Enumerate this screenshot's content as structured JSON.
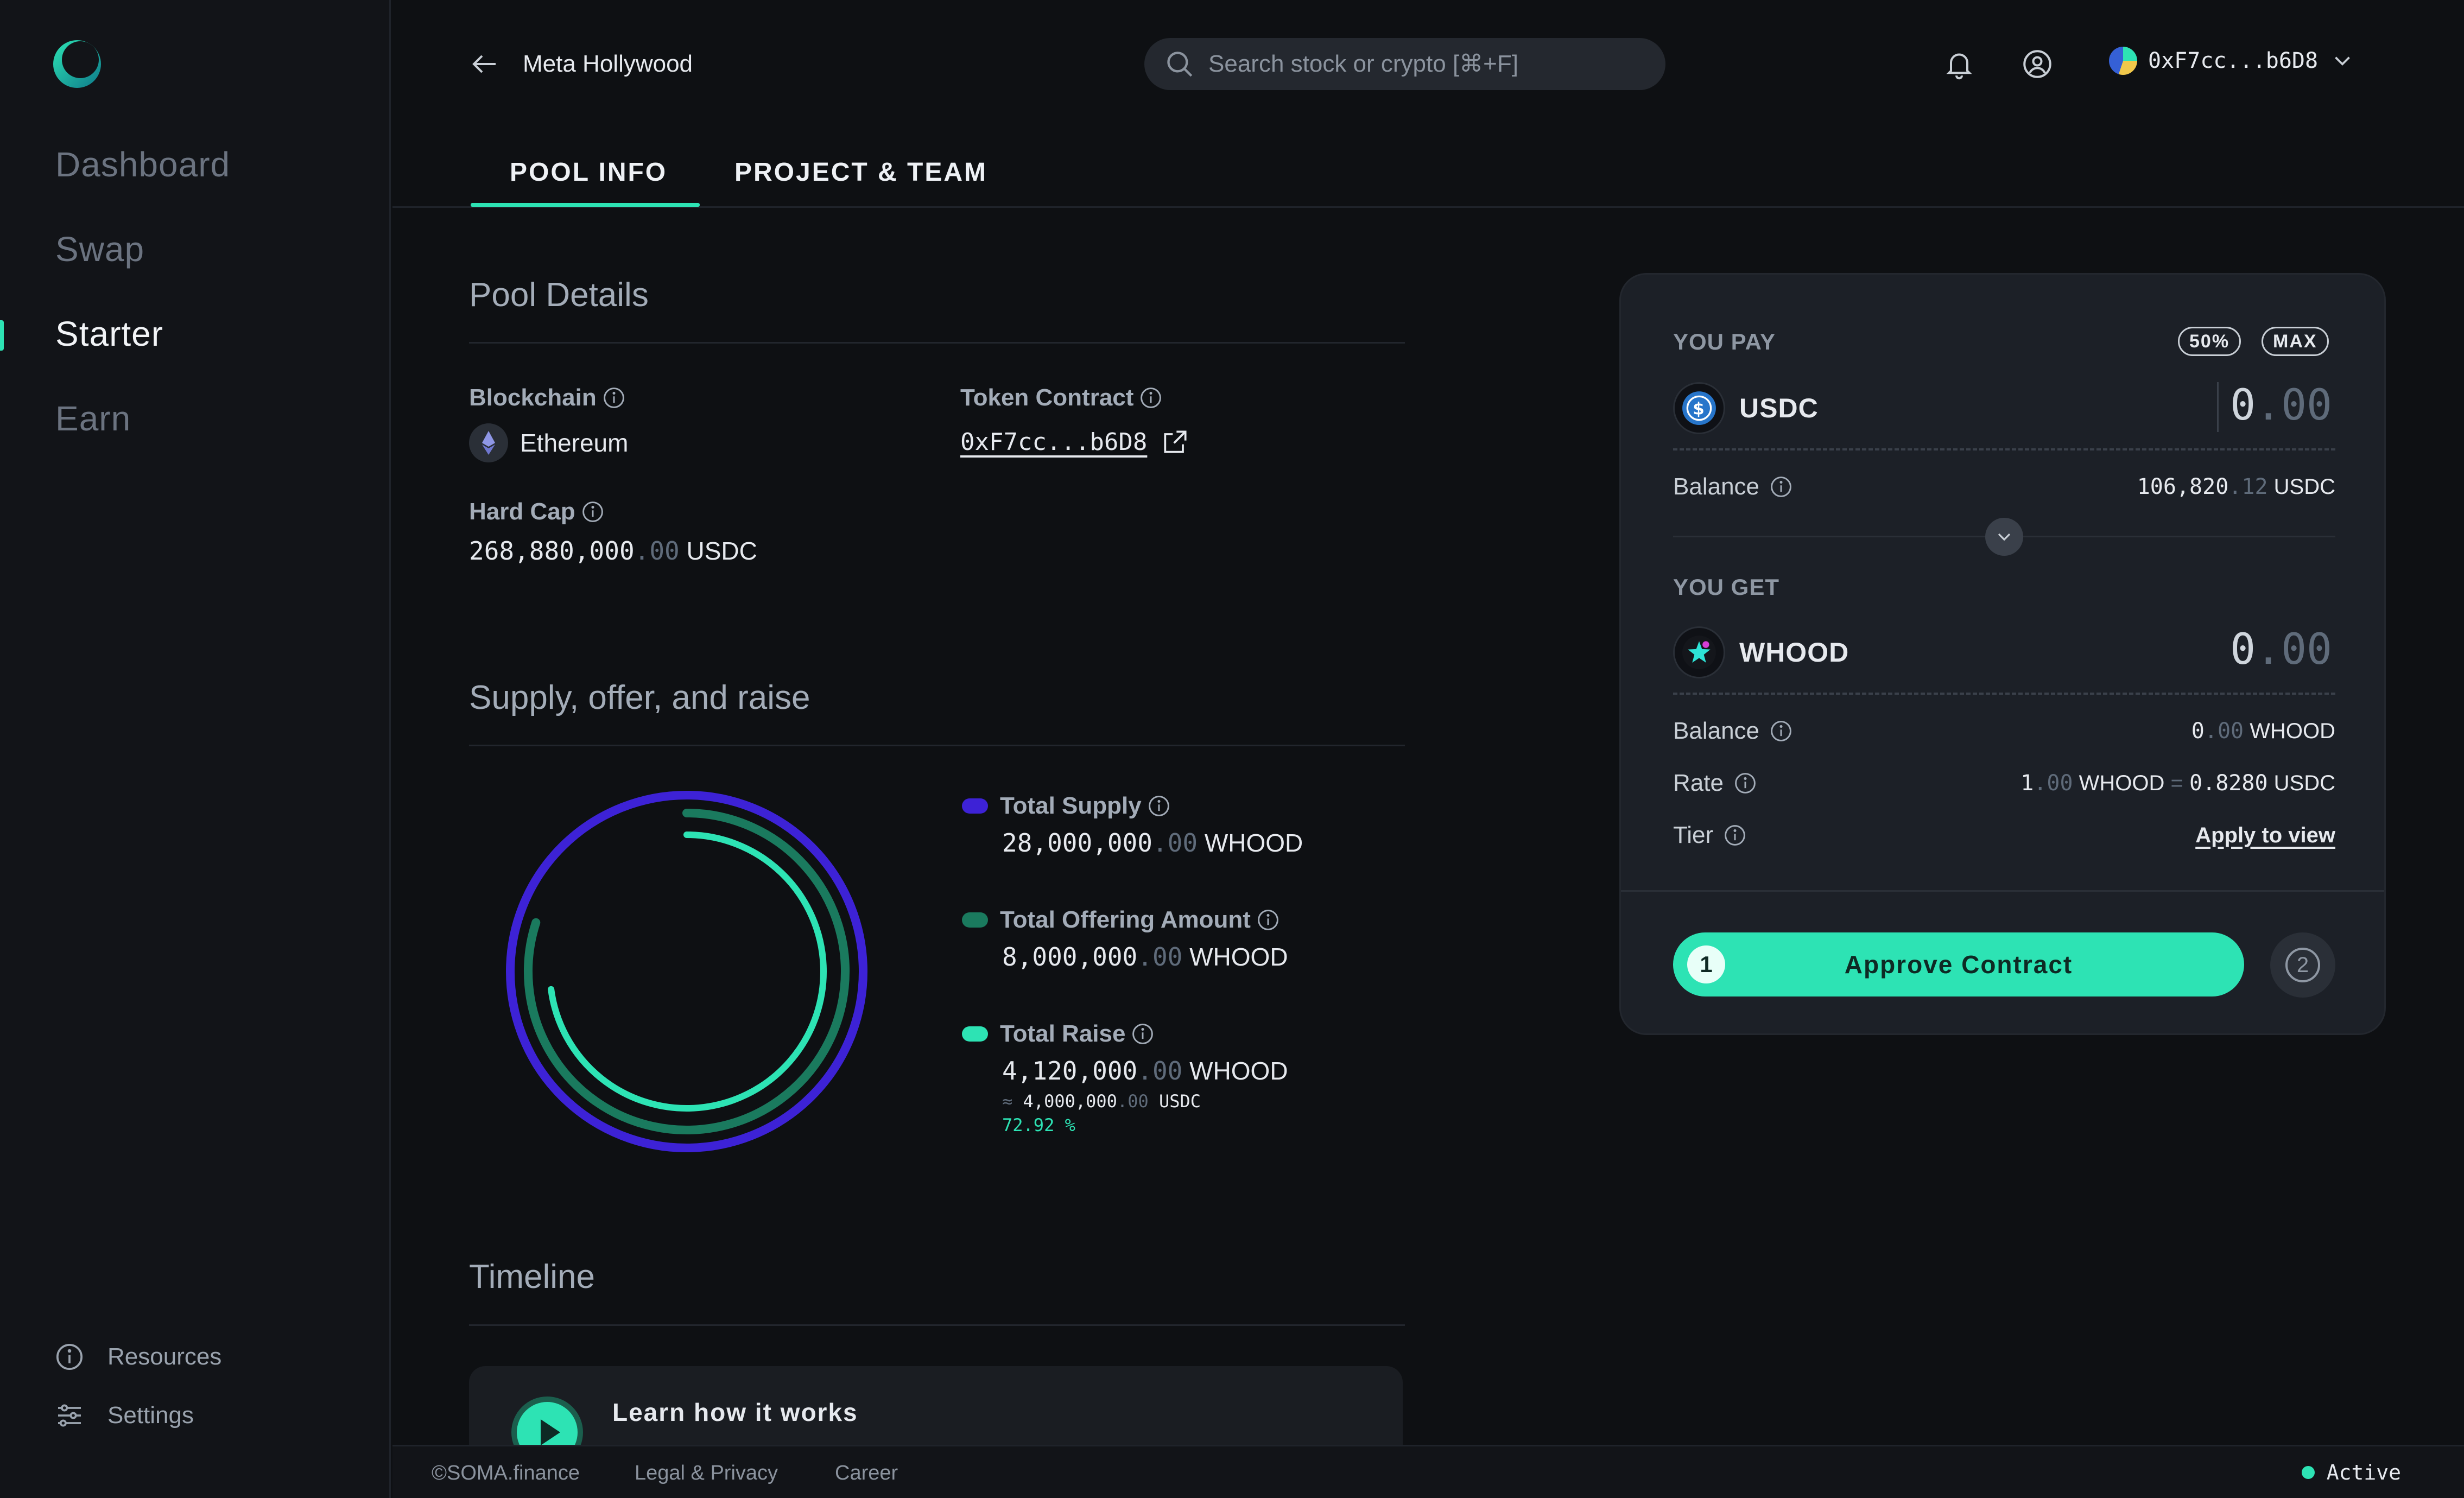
{
  "sidebar": {
    "items": [
      {
        "label": "Dashboard"
      },
      {
        "label": "Swap"
      },
      {
        "label": "Starter"
      },
      {
        "label": "Earn"
      }
    ],
    "active": "Starter",
    "bottom": [
      {
        "label": "Resources",
        "icon": "info-icon"
      },
      {
        "label": "Settings",
        "icon": "sliders-icon"
      }
    ]
  },
  "header": {
    "back_label": "Meta Hollywood",
    "search_placeholder": "Search stock or crypto [⌘+F]",
    "wallet_address": "0xF7cc...b6D8"
  },
  "tabs": [
    {
      "label": "POOL INFO",
      "active": true
    },
    {
      "label": "PROJECT & TEAM",
      "active": false
    }
  ],
  "pool_details": {
    "title": "Pool Details",
    "blockchain_label": "Blockchain",
    "blockchain_value": "Ethereum",
    "token_contract_label": "Token Contract",
    "token_contract_value": "0xF7cc...b6D8",
    "hard_cap_label": "Hard Cap",
    "hard_cap_int": "268,880,000",
    "hard_cap_dec": ".00",
    "hard_cap_unit": "USDC"
  },
  "supply": {
    "title": "Supply, offer, and raise",
    "total_supply": {
      "label": "Total Supply",
      "int": "28,000,000",
      "dec": ".00",
      "unit": "WHOOD",
      "color": "#3d22d6"
    },
    "total_offering": {
      "label": "Total Offering Amount",
      "int": "8,000,000",
      "dec": ".00",
      "unit": "WHOOD",
      "color": "#1a7a5e"
    },
    "total_raise": {
      "label": "Total Raise",
      "int": "4,120,000",
      "dec": ".00",
      "unit": "WHOOD",
      "color": "#2de3b4",
      "approx_prefix": "≈",
      "approx_int": "4,000,000",
      "approx_dec": ".00",
      "approx_unit": "USDC",
      "percent": "72.92",
      "percent_sign": "%"
    }
  },
  "timeline": {
    "title": "Timeline",
    "learn_title": "Learn how it works"
  },
  "swap_panel": {
    "you_pay_label": "YOU PAY",
    "chip_50": "50%",
    "chip_max": "MAX",
    "pay_token": "USDC",
    "pay_amount_int": "0",
    "pay_amount_dec": ".00",
    "pay_balance_label": "Balance",
    "pay_balance_int": "106,820",
    "pay_balance_dec": ".12",
    "pay_balance_unit": "USDC",
    "you_get_label": "YOU GET",
    "get_token": "WHOOD",
    "get_amount_int": "0",
    "get_amount_dec": ".00",
    "get_balance_label": "Balance",
    "get_balance_int": "0",
    "get_balance_dec": ".00",
    "get_balance_unit": "WHOOD",
    "rate_label": "Rate",
    "rate_left_int": "1",
    "rate_left_dec": ".00",
    "rate_left_unit": "WHOOD",
    "rate_eq": "=",
    "rate_right": "0.8280",
    "rate_right_unit": "USDC",
    "tier_label": "Tier",
    "tier_link": "Apply to view",
    "approve_label": "Approve Contract",
    "step1": "1",
    "step2": "2"
  },
  "donut_values": {
    "total_supply_fraction": 1.0,
    "total_offering_fraction": 0.8,
    "total_raise_fraction": 0.7292
  },
  "footer": {
    "copyright": "©SOMA.finance",
    "legal": "Legal & Privacy",
    "career": "Career",
    "status": "Active"
  },
  "colors": {
    "accent": "#2de3b4",
    "background": "#0e1013",
    "panel": "#1c2027",
    "supply": "#3d22d6"
  }
}
